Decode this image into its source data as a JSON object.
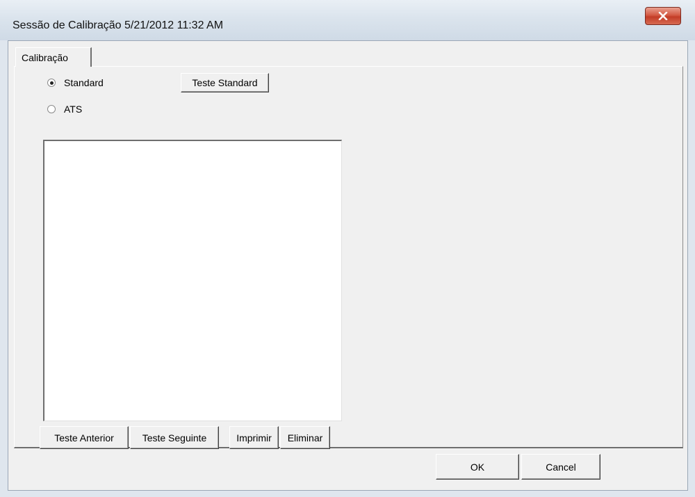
{
  "window": {
    "title": "Sessão de Calibração 5/21/2012 11:32 AM",
    "close_icon": "close-icon"
  },
  "tabs": [
    {
      "label": "Calibração",
      "selected": true
    }
  ],
  "mode": {
    "options": [
      {
        "label": "Standard",
        "checked": true
      },
      {
        "label": "ATS",
        "checked": false
      }
    ]
  },
  "buttons": {
    "test_standard": "Teste Standard",
    "previous_test": "Teste Anterior",
    "next_test": "Teste Seguinte",
    "print": "Imprimir",
    "delete": "Eliminar",
    "ok": "OK",
    "cancel": "Cancel"
  },
  "list": {
    "items": []
  }
}
